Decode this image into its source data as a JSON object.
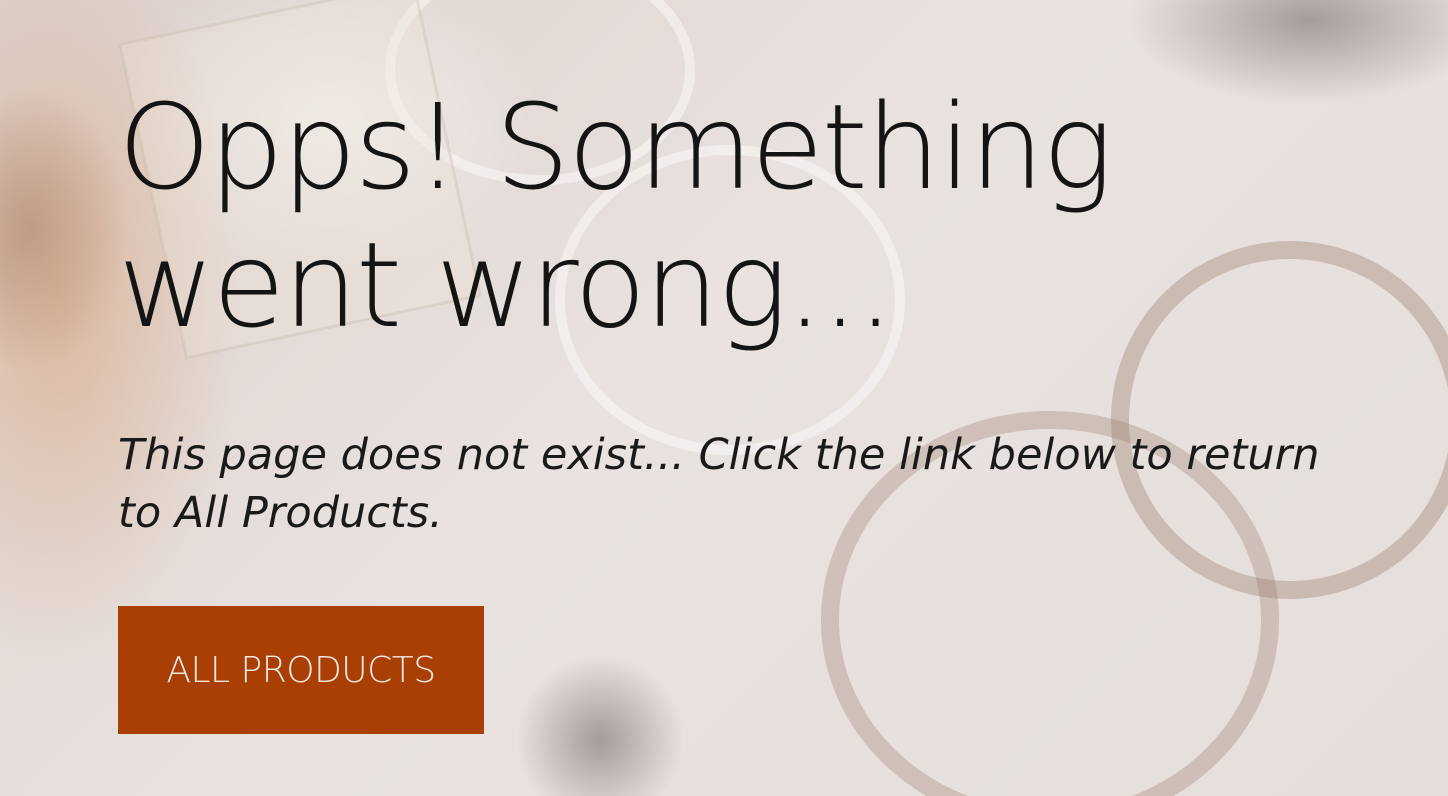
{
  "error": {
    "title": "Opps! Something went wrong...",
    "message": "This page does not exist... Click the link below to return to All Products."
  },
  "actions": {
    "all_products_label": "ALL PRODUCTS"
  },
  "colors": {
    "button_bg": "#aa3f06",
    "button_text": "#f3e9e3",
    "text": "#141414"
  }
}
